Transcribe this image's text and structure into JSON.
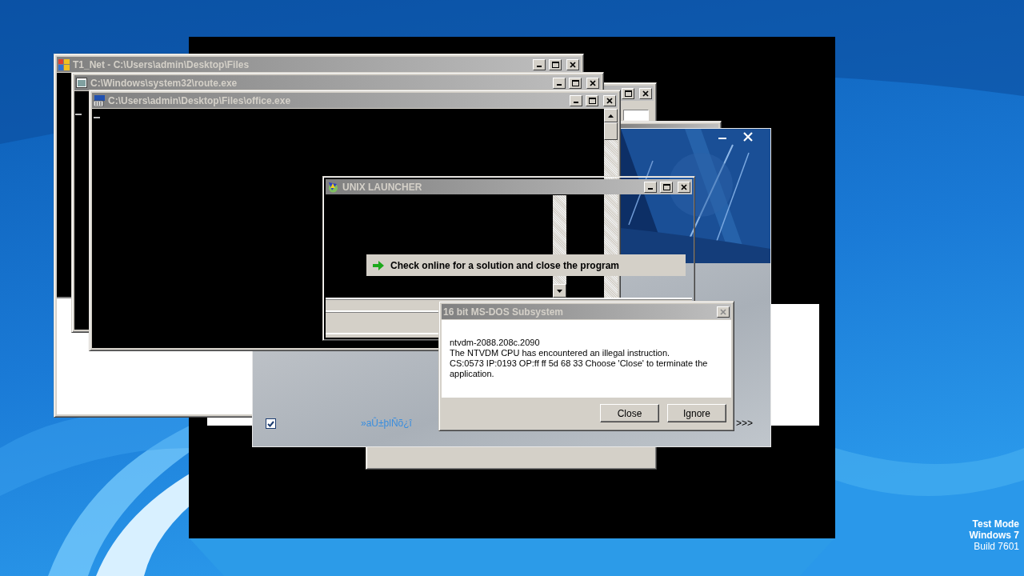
{
  "windows": [
    {
      "kind": "console",
      "title": "T1_Net - C:\\Users\\admin\\Desktop\\Files"
    },
    {
      "kind": "console",
      "title": "C:\\Windows\\system32\\route.exe"
    },
    {
      "kind": "console",
      "title": "C:\\Users\\admin\\Desktop\\Files\\office.exe"
    },
    {
      "kind": "launcher",
      "title": "UNIX LAUNCHER"
    }
  ],
  "setup_panel": {
    "checkbox": {
      "checked": true
    },
    "label": "»aÛ±þlÑõ¿î",
    "next_label": ">>>"
  },
  "solution_option": {
    "text": "Check online for a solution and close the program"
  },
  "dialog": {
    "title": "16 bit MS-DOS Subsystem",
    "message": [
      "ntvdm-2088.208c.2090",
      "The NTVDM CPU has encountered an illegal instruction.",
      "CS:0573 IP:0193 OP:ff ff 5d 68 33 Choose 'Close' to terminate the application."
    ],
    "buttons": [
      "Close",
      "Ignore"
    ]
  },
  "desktop_stamp": [
    "Test Mode",
    "Windows 7",
    "Build 7601"
  ]
}
